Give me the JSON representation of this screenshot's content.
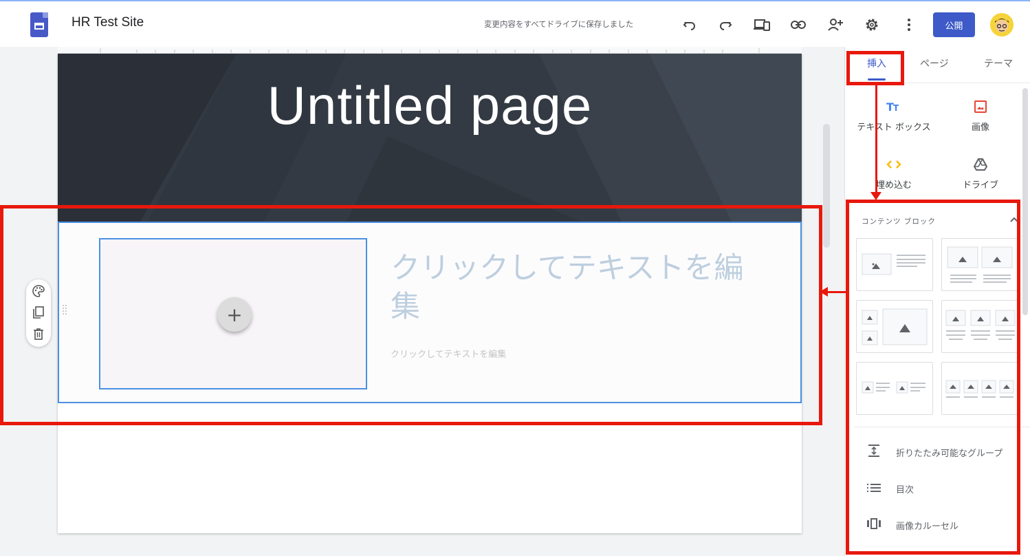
{
  "app": {
    "site_title": "HR Test Site",
    "save_status": "変更内容をすべてドライブに保存しました",
    "publish_label": "公開"
  },
  "toolbar": {
    "icons": [
      "undo-icon",
      "redo-icon",
      "preview-devices-icon",
      "link-icon",
      "share-add-person-icon",
      "gear-icon",
      "more-vert-icon"
    ]
  },
  "page": {
    "title": "Untitled page",
    "section": {
      "heading_placeholder": "クリックしてテキストを編集",
      "body_placeholder": "クリックしてテキストを編集",
      "add_label": "+"
    }
  },
  "panel": {
    "tabs": [
      {
        "label": "挿入",
        "active": true
      },
      {
        "label": "ページ",
        "active": false
      },
      {
        "label": "テーマ",
        "active": false
      }
    ],
    "insert_items": [
      {
        "label": "テキスト ボックス",
        "icon": "text-box-icon"
      },
      {
        "label": "画像",
        "icon": "image-icon"
      },
      {
        "label": "埋め込む",
        "icon": "embed-icon"
      },
      {
        "label": "ドライブ",
        "icon": "drive-icon"
      }
    ],
    "content_blocks_header": "コンテンツ ブロック",
    "list_items": [
      {
        "label": "折りたたみ可能なグループ",
        "icon": "collapsible-group-icon"
      },
      {
        "label": "目次",
        "icon": "table-of-contents-icon"
      },
      {
        "label": "画像カルーセル",
        "icon": "image-carousel-icon"
      }
    ]
  },
  "colors": {
    "accent": "#3d5ac8",
    "annotation_red": "#e8180c",
    "selection_blue": "#4a90e2",
    "banner": "#343a43"
  }
}
